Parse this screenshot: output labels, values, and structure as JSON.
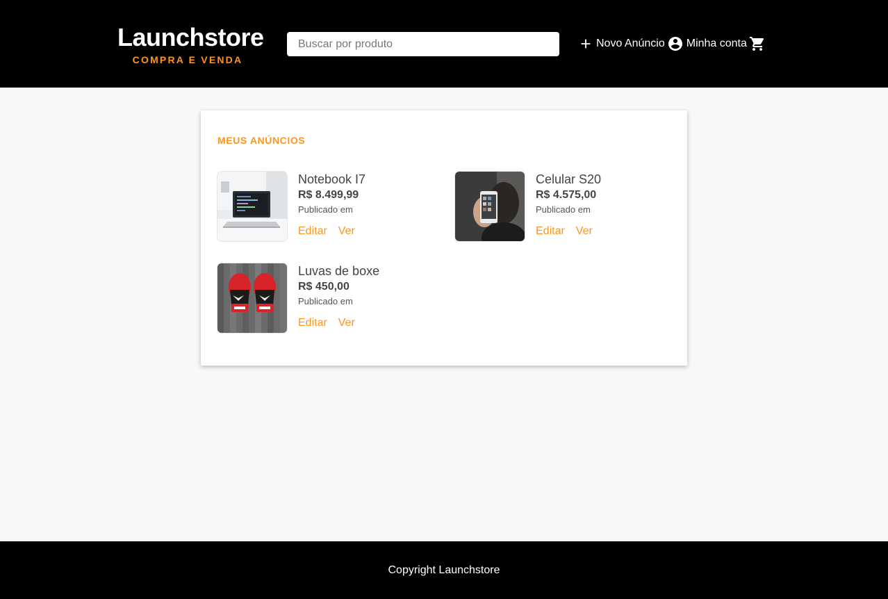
{
  "header": {
    "logo_name": "Launchstore",
    "logo_tagline": "COMPRA E VENDA",
    "search_placeholder": "Buscar por produto",
    "nav": {
      "new_ad_label": "Novo Anúncio",
      "account_label": "Minha conta"
    },
    "icons": [
      "add-icon",
      "account-circle-icon",
      "shopping-cart-icon"
    ]
  },
  "main": {
    "section_title": "MEUS ANÚNCIOS",
    "products": [
      {
        "title": "Notebook I7",
        "price": "R$ 8.499,99",
        "published": "Publicado em",
        "edit_label": "Editar",
        "view_label": "Ver",
        "image": "laptop-photo"
      },
      {
        "title": "Celular S20",
        "price": "R$ 4.575,00",
        "published": "Publicado em",
        "edit_label": "Editar",
        "view_label": "Ver",
        "image": "smartphone-photo"
      },
      {
        "title": "Luvas de boxe",
        "price": "R$ 450,00",
        "published": "Publicado em",
        "edit_label": "Editar",
        "view_label": "Ver",
        "image": "boxing-gloves-photo"
      }
    ]
  },
  "footer": {
    "copyright": "Copyright Launchstore"
  },
  "colors": {
    "accent": "#fd951f",
    "header_bg": "#000000",
    "page_bg": "#f8f8f8",
    "card_bg": "#ffffff"
  }
}
